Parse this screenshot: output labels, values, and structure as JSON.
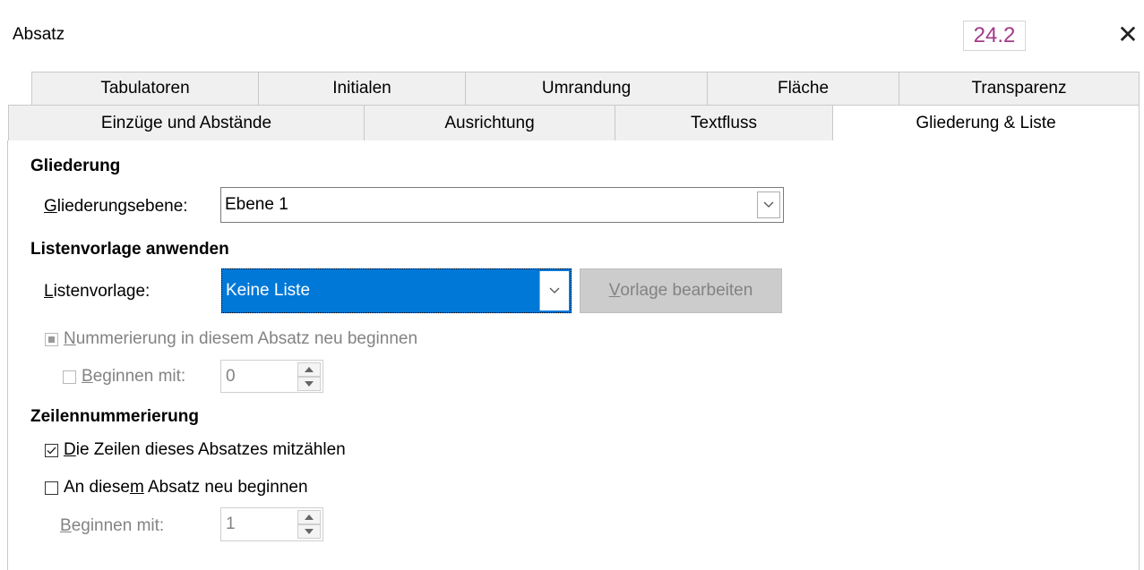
{
  "dialog": {
    "title": "Absatz",
    "version_badge": "24.2",
    "close_icon": "close-icon"
  },
  "tabs_row1": [
    "Tabulatoren",
    "Initialen",
    "Umrandung",
    "Fläche",
    "Transparenz"
  ],
  "tabs_row2": [
    "Einzüge und Abstände",
    "Ausrichtung",
    "Textfluss",
    "Gliederung & Liste"
  ],
  "active_tab": "Gliederung & Liste",
  "gliederung": {
    "heading": "Gliederung",
    "level_label": {
      "first": "G",
      "rest": "liederungsebene:"
    },
    "level_value": "Ebene 1"
  },
  "liste": {
    "heading": "Listenvorlage anwenden",
    "label": {
      "first": "L",
      "rest": "istenvorlage:"
    },
    "value": "Keine Liste",
    "edit_button": {
      "first": "V",
      "rest": "orlage bearbeiten"
    },
    "restart": {
      "first": "N",
      "rest": "ummerierung in diesem Absatz neu beginnen"
    },
    "start_with": {
      "first": "B",
      "rest": "eginnen mit:"
    },
    "start_value": "0"
  },
  "zeilen": {
    "heading": "Zeilennummerierung",
    "count_lines": {
      "first": "D",
      "rest": "ie Zeilen dieses Absatzes mitzählen",
      "checked": true
    },
    "restart_here": {
      "pre": "An diese",
      "u": "m",
      "post": " Absatz neu beginnen",
      "checked": false
    },
    "start_with": {
      "first": "B",
      "rest": "eginnen mit:"
    },
    "start_value": "1"
  },
  "colors": {
    "accent": "#0078d7",
    "badge": "#a23b88",
    "disabled": "#838383"
  }
}
